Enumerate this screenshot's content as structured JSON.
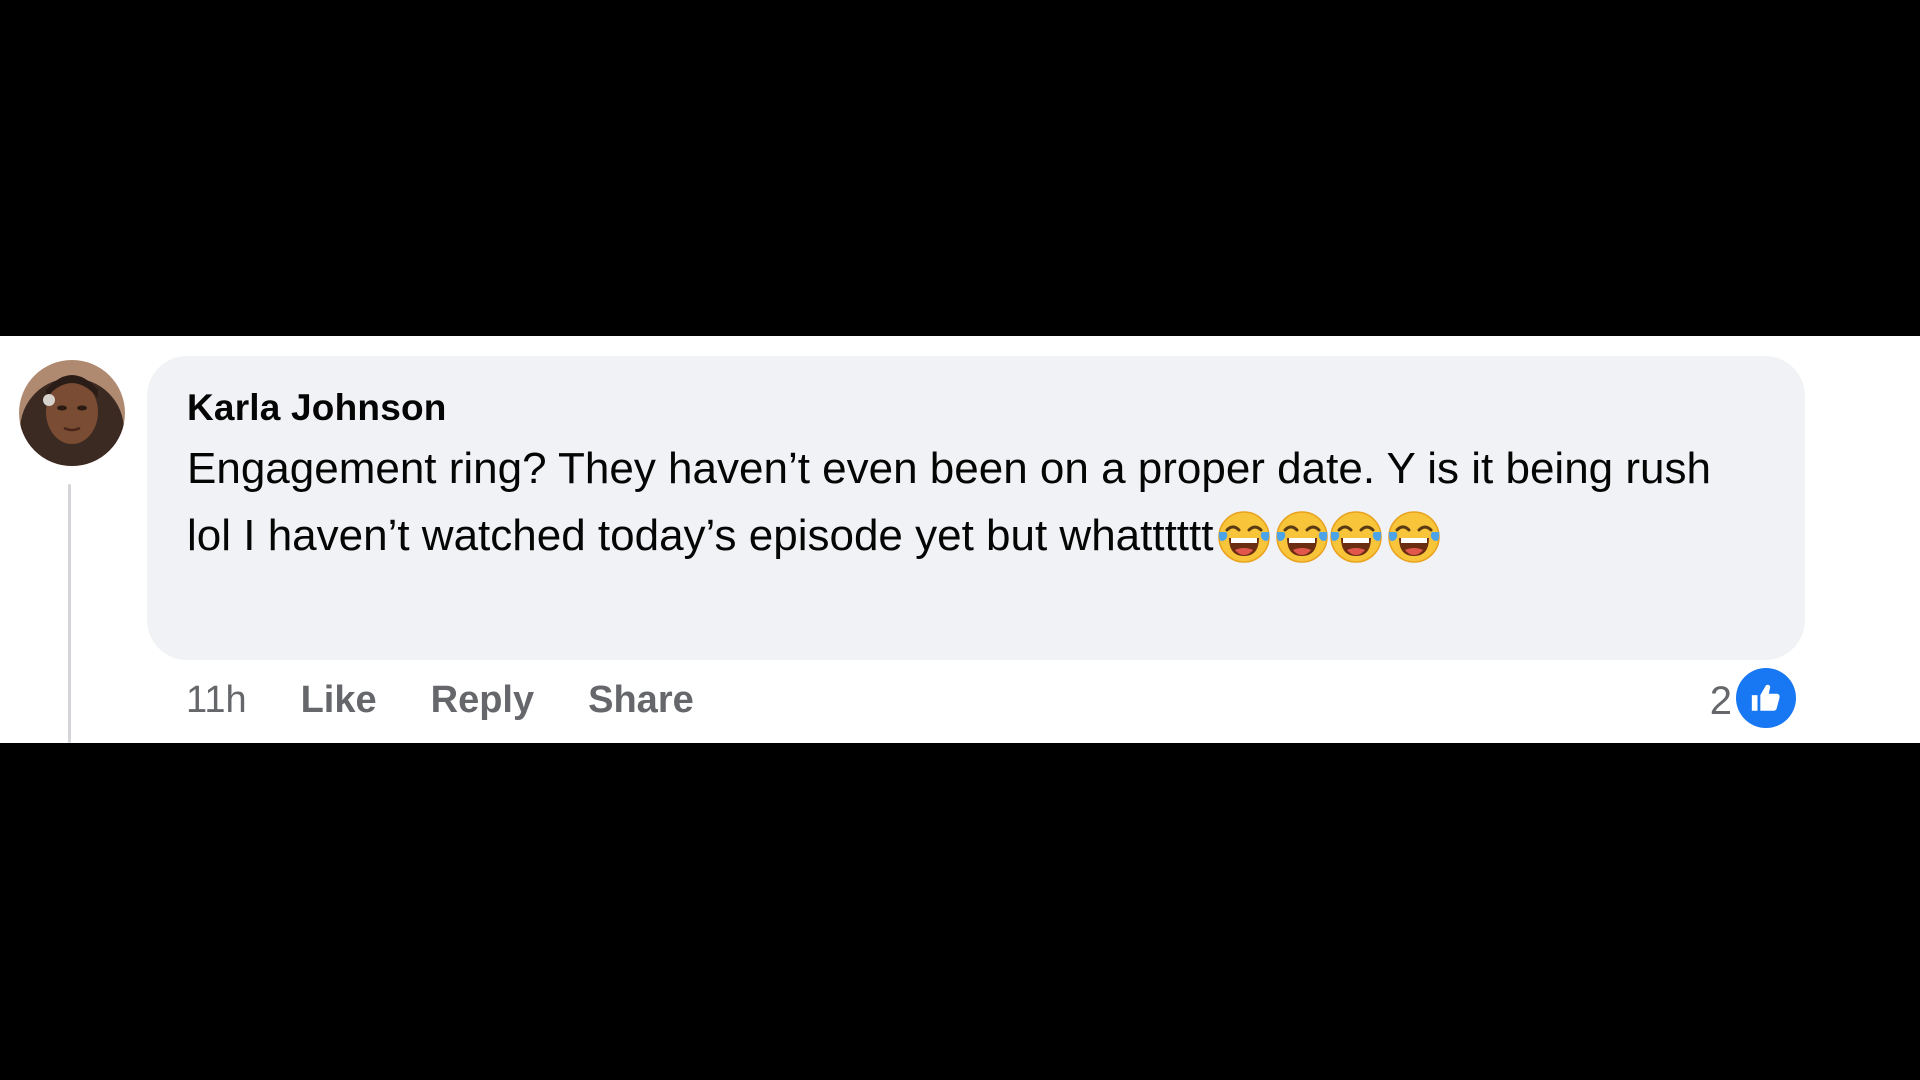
{
  "comment": {
    "author": "Karla Johnson",
    "text": "Engagement ring? They haven’t even been on a proper date. Y is it being rush lol I haven’t watched today’s episode yet but whatttttt",
    "emoji_icon": "face-with-tears-of-joy-icon",
    "emoji_count": 4
  },
  "actions": {
    "time": "11h",
    "like_label": "Like",
    "reply_label": "Reply",
    "share_label": "Share"
  },
  "reactions": {
    "count": "2",
    "icon": "thumbs-up-icon",
    "badge_color": "#1877f2"
  },
  "colors": {
    "bubble_bg": "#f0f2f5",
    "text": "#050505",
    "secondary_text": "#65676b",
    "thread_line": "#d3d5d9"
  }
}
